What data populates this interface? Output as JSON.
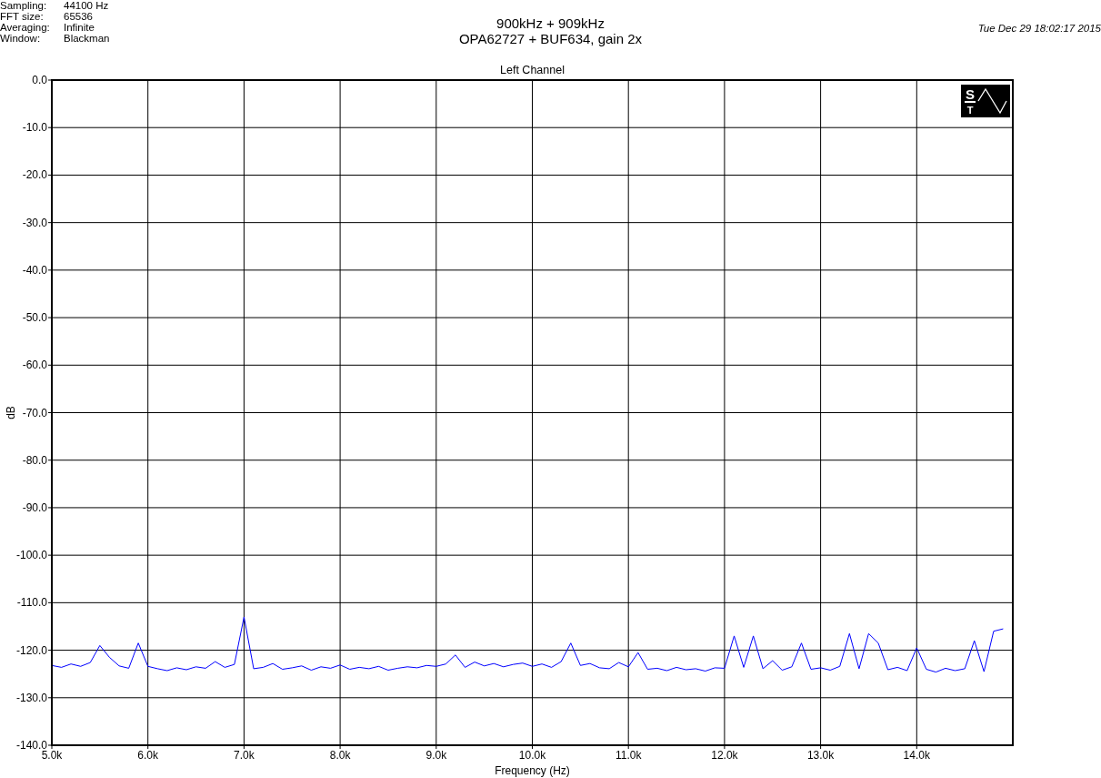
{
  "info": [
    {
      "label": "Sampling:",
      "value": "44100 Hz"
    },
    {
      "label": "FFT size:",
      "value": "65536"
    },
    {
      "label": "Averaging:",
      "value": "Infinite"
    },
    {
      "label": "Window:",
      "value": "Blackman"
    }
  ],
  "title_lines": [
    "900kHz + 909kHz",
    "OPA62727 + BUF634, gain 2x"
  ],
  "timestamp": "Tue Dec 29 18:02:17 2015",
  "logo": {
    "top": "S",
    "bottom": "T"
  },
  "chart_data": {
    "type": "line",
    "title": "Left Channel",
    "xlabel": "Frequency (Hz)",
    "ylabel": "dB",
    "xlim": [
      5000,
      15000
    ],
    "ylim": [
      -140,
      0
    ],
    "xticks": [
      {
        "value": 5000,
        "label": "5.0k"
      },
      {
        "value": 6000,
        "label": "6.0k"
      },
      {
        "value": 7000,
        "label": "7.0k"
      },
      {
        "value": 8000,
        "label": "8.0k"
      },
      {
        "value": 9000,
        "label": "9.0k"
      },
      {
        "value": 10000,
        "label": "10.0k"
      },
      {
        "value": 11000,
        "label": "11.0k"
      },
      {
        "value": 12000,
        "label": "12.0k"
      },
      {
        "value": 13000,
        "label": "13.0k"
      },
      {
        "value": 14000,
        "label": "14.0k"
      }
    ],
    "yticks": [
      {
        "value": 0,
        "label": "0.0"
      },
      {
        "value": -10,
        "label": "-10.0"
      },
      {
        "value": -20,
        "label": "-20.0"
      },
      {
        "value": -30,
        "label": "-30.0"
      },
      {
        "value": -40,
        "label": "-40.0"
      },
      {
        "value": -50,
        "label": "-50.0"
      },
      {
        "value": -60,
        "label": "-60.0"
      },
      {
        "value": -70,
        "label": "-70.0"
      },
      {
        "value": -80,
        "label": "-80.0"
      },
      {
        "value": -90,
        "label": "-90.0"
      },
      {
        "value": -100,
        "label": "-100.0"
      },
      {
        "value": -110,
        "label": "-110.0"
      },
      {
        "value": -120,
        "label": "-120.0"
      },
      {
        "value": -130,
        "label": "-130.0"
      },
      {
        "value": -140,
        "label": "-140.0"
      }
    ],
    "x": [
      5000,
      5100,
      5200,
      5300,
      5400,
      5500,
      5600,
      5700,
      5800,
      5900,
      6000,
      6100,
      6200,
      6300,
      6400,
      6500,
      6600,
      6700,
      6800,
      6900,
      7000,
      7100,
      7200,
      7300,
      7400,
      7500,
      7600,
      7700,
      7800,
      7900,
      8000,
      8100,
      8200,
      8300,
      8400,
      8500,
      8600,
      8700,
      8800,
      8900,
      9000,
      9100,
      9200,
      9300,
      9400,
      9500,
      9600,
      9700,
      9800,
      9900,
      10000,
      10100,
      10200,
      10300,
      10400,
      10500,
      10600,
      10700,
      10800,
      10900,
      11000,
      11100,
      11200,
      11300,
      11400,
      11500,
      11600,
      11700,
      11800,
      11900,
      12000,
      12100,
      12200,
      12300,
      12400,
      12500,
      12600,
      12700,
      12800,
      12900,
      13000,
      13100,
      13200,
      13300,
      13400,
      13500,
      13600,
      13700,
      13800,
      13900,
      14000,
      14100,
      14200,
      14300,
      14400,
      14500,
      14600,
      14700,
      14800,
      14900
    ],
    "grid": true,
    "series": [
      {
        "color": "#0000ff",
        "values": [
          -123.2,
          -123.6,
          -122.9,
          -123.4,
          -122.6,
          -119,
          -121.5,
          -123.3,
          -123.8,
          -118.5,
          -123.4,
          -123.9,
          -124.3,
          -123.7,
          -124.1,
          -123.5,
          -123.8,
          -122.4,
          -123.6,
          -123.0,
          -113,
          -123.9,
          -123.6,
          -122.8,
          -124.0,
          -123.7,
          -123.3,
          -124.2,
          -123.5,
          -123.8,
          -123.1,
          -124.0,
          -123.6,
          -123.9,
          -123.4,
          -124.2,
          -123.8,
          -123.5,
          -123.7,
          -123.2,
          -123.4,
          -122.9,
          -121,
          -123.6,
          -122.5,
          -123.3,
          -122.8,
          -123.5,
          -123.0,
          -122.7,
          -123.4,
          -122.9,
          -123.6,
          -122.4,
          -118.5,
          -123.2,
          -122.8,
          -123.7,
          -123.9,
          -122.6,
          -123.5,
          -120.5,
          -124.0,
          -123.8,
          -124.3,
          -123.6,
          -124.1,
          -123.9,
          -124.4,
          -123.7,
          -123.8,
          -117,
          -123.6,
          -117,
          -123.9,
          -122.2,
          -124.2,
          -123.5,
          -118.5,
          -124.0,
          -123.7,
          -124.2,
          -123.4,
          -116.5,
          -123.9,
          -116.5,
          -118.5,
          -124.1,
          -123.6,
          -124.3,
          -119.5,
          -124.0,
          -124.6,
          -123.8,
          -124.3,
          -123.9,
          -118,
          -124.5,
          -116,
          -115.5
        ]
      }
    ]
  }
}
